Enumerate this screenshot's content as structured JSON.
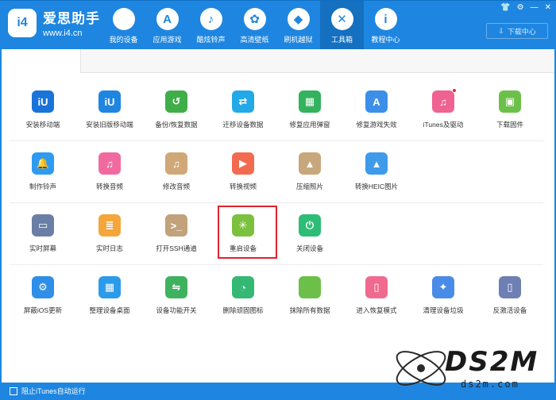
{
  "header": {
    "logo_badge": "i4",
    "logo_name": "爱思助手",
    "logo_url": "www.i4.cn",
    "download_label": "下载中心",
    "nav": [
      {
        "label": "我的设备",
        "icon": "apple-icon",
        "glyph": ""
      },
      {
        "label": "应用游戏",
        "icon": "app-store-icon",
        "glyph": "A"
      },
      {
        "label": "酷炫铃声",
        "icon": "bell-icon",
        "glyph": "♪"
      },
      {
        "label": "高清壁纸",
        "icon": "flower-icon",
        "glyph": "✿"
      },
      {
        "label": "刷机越狱",
        "icon": "dropbox-icon",
        "glyph": "◆"
      },
      {
        "label": "工具箱",
        "icon": "tools-icon",
        "glyph": "✕",
        "active": true
      },
      {
        "label": "教程中心",
        "icon": "info-icon",
        "glyph": "i"
      }
    ]
  },
  "rows": [
    [
      {
        "label": "安装移动端",
        "icon": "i4-mobile-icon",
        "color": "#1a73d9",
        "glyph": "iU"
      },
      {
        "label": "安装旧版移动端",
        "icon": "i4-old-mobile-icon",
        "color": "#1e86e0",
        "glyph": "iU"
      },
      {
        "label": "备份/恢复数据",
        "icon": "backup-clock-icon",
        "color": "#3fae49",
        "glyph": "↺"
      },
      {
        "label": "迁移设备数据",
        "icon": "migrate-icon",
        "color": "#22a9e8",
        "glyph": "⇄"
      },
      {
        "label": "修复应用弹窗",
        "icon": "keyboard-icon",
        "color": "#33b35e",
        "glyph": "▦"
      },
      {
        "label": "修复游戏失效",
        "icon": "app-repair-icon",
        "color": "#3b8fe8",
        "glyph": "A"
      },
      {
        "label": "iTunes及驱动",
        "icon": "itunes-icon",
        "color": "#f06292",
        "glyph": "♫",
        "dot": true
      },
      {
        "label": "下载固件",
        "icon": "cube-icon",
        "color": "#6cc04a",
        "glyph": "▣"
      }
    ],
    [
      {
        "label": "制作铃声",
        "icon": "ringtone-icon",
        "color": "#2e9bf0",
        "glyph": "🔔"
      },
      {
        "label": "转换音频",
        "icon": "audio-icon",
        "color": "#f06aa0",
        "glyph": "♫"
      },
      {
        "label": "修改音频",
        "icon": "edit-audio-icon",
        "color": "#d0a877",
        "glyph": "♫"
      },
      {
        "label": "转换视频",
        "icon": "video-icon",
        "color": "#f26b50",
        "glyph": "▶"
      },
      {
        "label": "压缩照片",
        "icon": "photo-icon",
        "color": "#c9a77c",
        "glyph": "▲"
      },
      {
        "label": "转换HEIC图片",
        "icon": "heic-icon",
        "color": "#3d9be9",
        "glyph": "▲"
      }
    ],
    [
      {
        "label": "实时屏幕",
        "icon": "screen-icon",
        "color": "#6b7fa6",
        "glyph": "▭"
      },
      {
        "label": "实时日志",
        "icon": "log-icon",
        "color": "#f4a63b",
        "glyph": "≣"
      },
      {
        "label": "打开SSH通道",
        "icon": "terminal-icon",
        "color": "#c2a27b",
        "glyph": ">_"
      },
      {
        "label": "重启设备",
        "icon": "restart-icon",
        "color": "#7cc13e",
        "glyph": "✳"
      },
      {
        "label": "关闭设备",
        "icon": "power-icon",
        "color": "#2ebd76",
        "glyph": "⏻"
      }
    ],
    [
      {
        "label": "屏蔽iOS更新",
        "icon": "block-update-icon",
        "color": "#2e8ee8",
        "glyph": "⚙"
      },
      {
        "label": "整理设备桌面",
        "icon": "desktop-grid-icon",
        "color": "#2b9be9",
        "glyph": "▦"
      },
      {
        "label": "设备功能开关",
        "icon": "toggle-icon",
        "color": "#3fb25f",
        "glyph": "⇋"
      },
      {
        "label": "删除顽固图标",
        "icon": "pie-icon",
        "color": "#35b874",
        "glyph": "◔"
      },
      {
        "label": "抹除所有数据",
        "icon": "erase-apple-icon",
        "color": "#6cc04a",
        "glyph": ""
      },
      {
        "label": "进入恢复模式",
        "icon": "recovery-icon",
        "color": "#f06a8f",
        "glyph": "▯"
      },
      {
        "label": "清理设备垃圾",
        "icon": "broom-icon",
        "color": "#4a8be8",
        "glyph": "✦"
      },
      {
        "label": "反激活设备",
        "icon": "deactivate-icon",
        "color": "#6d7fb3",
        "glyph": "▯"
      }
    ]
  ],
  "footer": {
    "label": "阻止iTunes自动运行"
  },
  "watermark": {
    "brand": "DS2M",
    "url": "ds2m.com"
  }
}
